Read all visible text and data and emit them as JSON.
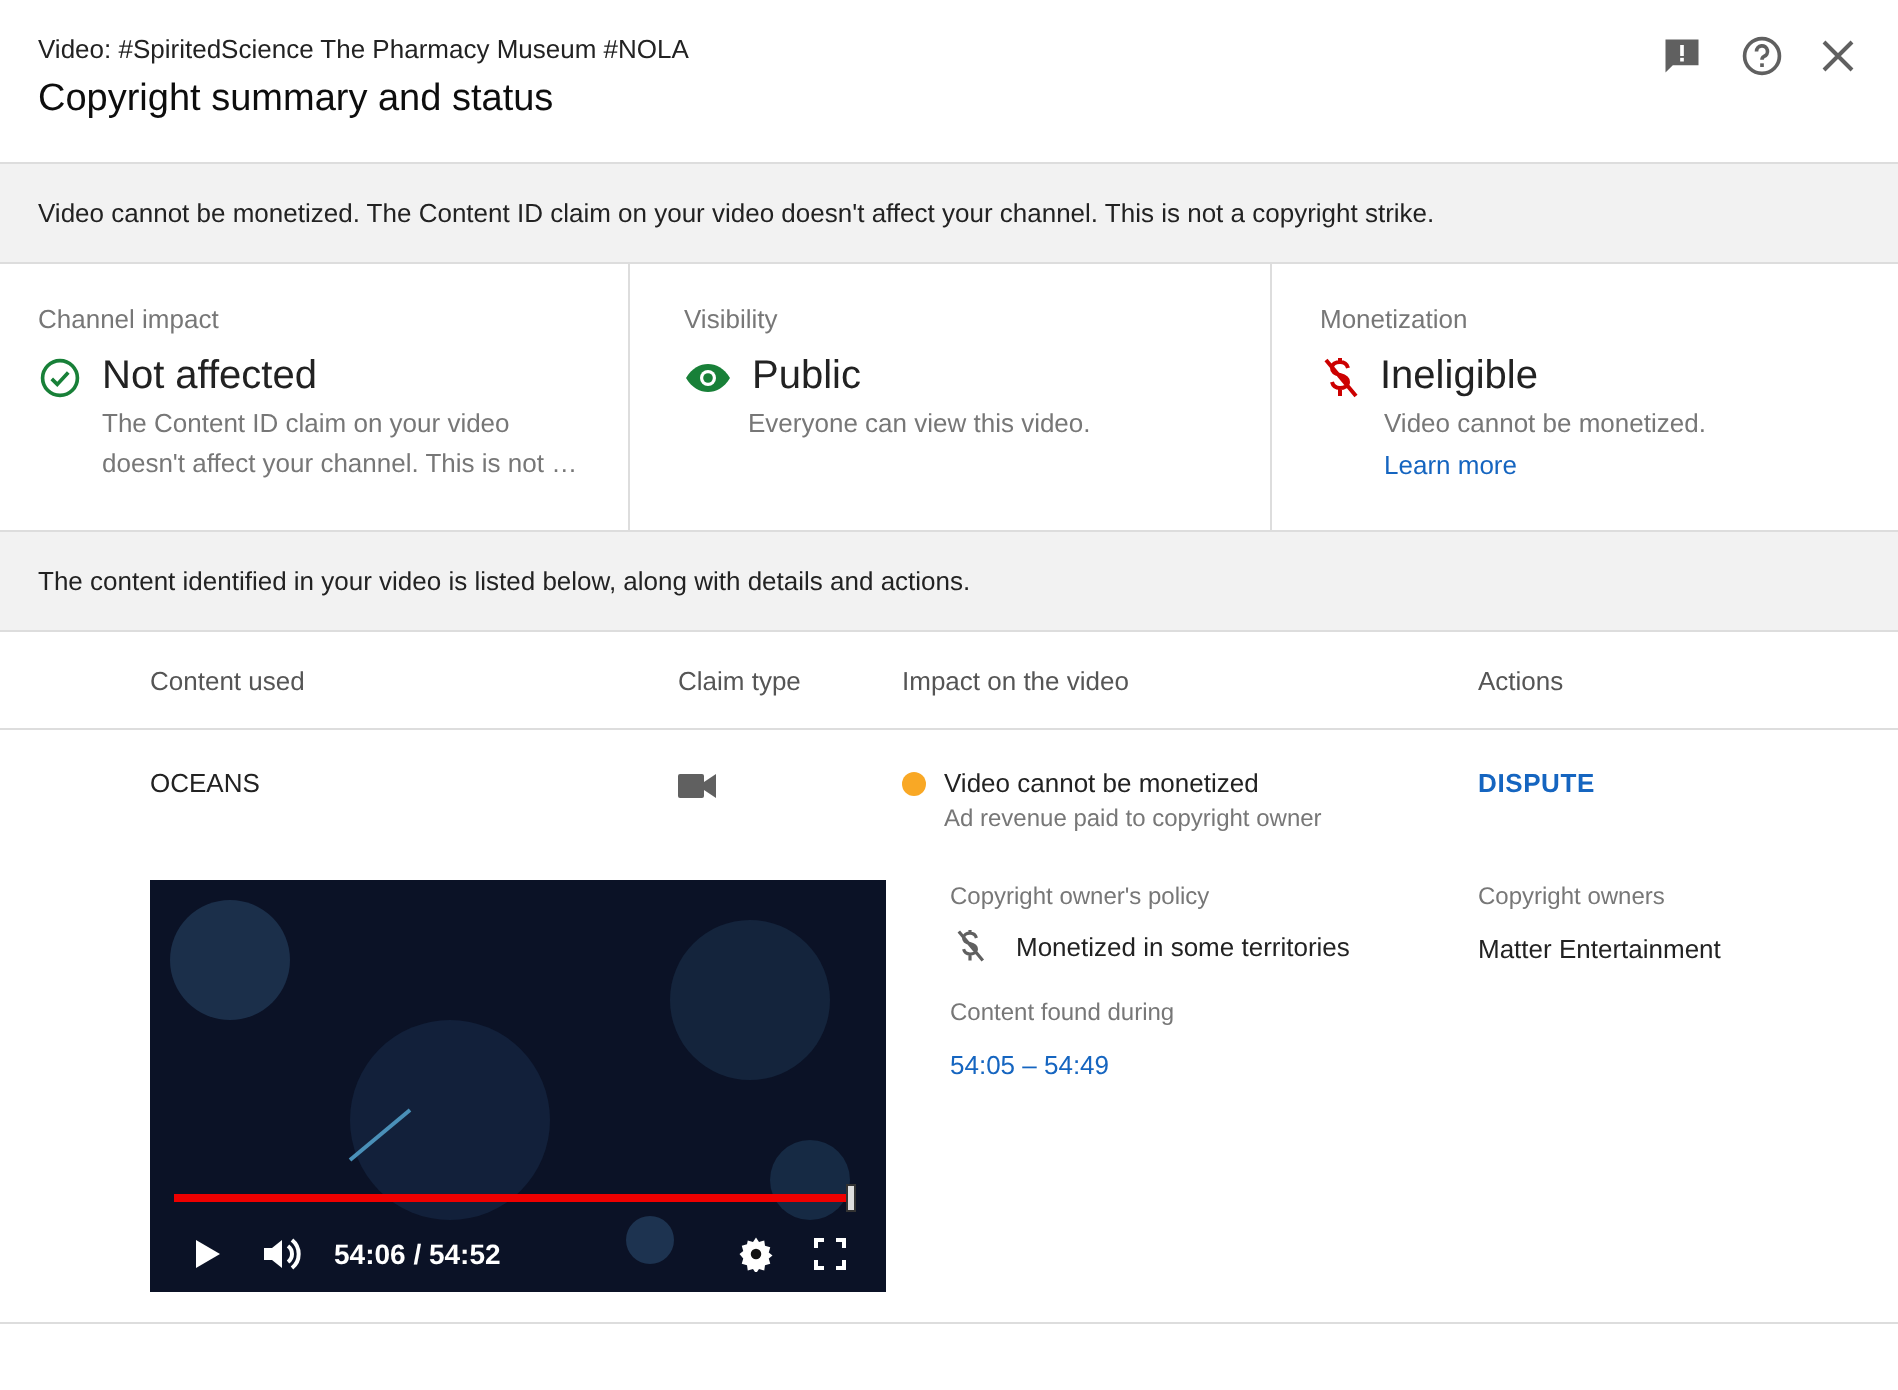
{
  "header": {
    "subtitle": "Video: #SpiritedScience The Pharmacy Museum #NOLA",
    "title": "Copyright summary and status"
  },
  "notice": "Video cannot be monetized. The Content ID claim on your video doesn't affect your channel. This is not a copyright strike.",
  "cards": [
    {
      "kind": "ok",
      "label": "Channel impact",
      "value": "Not affected",
      "detail": "The Content ID claim on your video doesn't affect your channel. This is not …"
    },
    {
      "kind": "public",
      "label": "Visibility",
      "value": "Public",
      "detail": "Everyone can view this video."
    },
    {
      "kind": "ineligible",
      "label": "Monetization",
      "value": "Ineligible",
      "detail": "Video cannot be monetized.",
      "link": "Learn more"
    }
  ],
  "intro": "The content identified in your video is listed below, along with details and actions.",
  "table": {
    "columns": [
      "Content used",
      "Claim type",
      "Impact on the video",
      "Actions"
    ],
    "rows": [
      {
        "content": "OCEANS",
        "impact": "Video cannot be monetized",
        "color": "#f9a825",
        "impact_detail": "Ad revenue paid to copyright owner",
        "action": "DISPUTE",
        "player": {
          "level": 0.99,
          "time": "54:06 / 54:52"
        },
        "policy_label": "Copyright owner's policy",
        "policy": "Monetized in some territories",
        "owners_label": "Copyright owners",
        "owners": "Matter Entertainment",
        "found_label": "Content found during",
        "found": "54:05 – 54:49"
      }
    ]
  }
}
